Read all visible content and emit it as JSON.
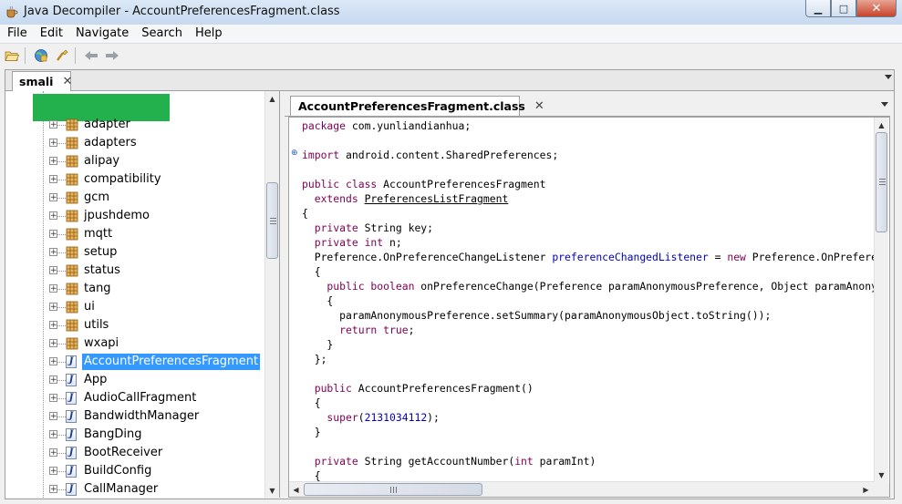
{
  "window": {
    "title": "Java Decompiler - AccountPreferencesFragment.class",
    "controls": {
      "minimize": "▁",
      "maximize": "□",
      "close": "✕"
    }
  },
  "menu": [
    "File",
    "Edit",
    "Navigate",
    "Search",
    "Help"
  ],
  "toolbar": {
    "buttons": [
      "open-file-icon",
      "open-type-icon",
      "search-icon",
      "back-arrow-icon",
      "forward-arrow-icon"
    ]
  },
  "outer_tab": {
    "label": "smali",
    "close": "✕"
  },
  "editor_tab": {
    "label": "AccountPreferencesFragment.class",
    "close": "✕"
  },
  "tree": {
    "packages": [
      "adapter",
      "adapters",
      "alipay",
      "compatibility",
      "gcm",
      "jpushdemo",
      "mqtt",
      "setup",
      "status",
      "tang",
      "ui",
      "utils",
      "wxapi"
    ],
    "classes": [
      "AccountPreferencesFragment",
      "App",
      "AudioCallFragment",
      "BandwidthManager",
      "BangDing",
      "BootReceiver",
      "BuildConfig",
      "CallManager"
    ],
    "selected": "AccountPreferencesFragment",
    "expander_symbol": "+",
    "class_icon_glyph": "J"
  },
  "code": {
    "package_kw": "package",
    "package_name": " com.yunliandianhua;",
    "import_kw": "import",
    "import_name": " android.content.SharedPreferences;",
    "class_decl_kw": "public class",
    "class_name": " AccountPreferencesFragment",
    "extends_kw": "  extends ",
    "extends_name": "PreferencesListFragment",
    "open_brace": "{",
    "field1_kw": "  private",
    "field1_rest": " String key;",
    "field2_kw": "  private int",
    "field2_rest": " n;",
    "listener_type": "  Preference.OnPreferenceChangeListener ",
    "listener_name": "preferenceChangedListener",
    "listener_eq": " = ",
    "listener_new": "new",
    "listener_rest": " Preference.OnPreferenceChangeListener()",
    "brace_l2_open": "  {",
    "method_kw": "    public boolean",
    "method_rest": " onPreferenceChange(Preference paramAnonymousPreference, Object paramAnonymousObject)",
    "brace_l3_open": "    {",
    "call_line": "      paramAnonymousPreference.setSummary(paramAnonymousObject.toString());",
    "return_kw": "      return true",
    "return_end": ";",
    "brace_l3_close": "    }",
    "brace_l2_close": "  };",
    "ctor_kw": "  public",
    "ctor_rest": " AccountPreferencesFragment()",
    "ctor_open": "  {",
    "super_kw": "    super",
    "super_open": "(",
    "super_num": "2131034112",
    "super_close": ");",
    "ctor_close": "  }",
    "getter_kw": "  private",
    "getter_mid": " String getAccountNumber(",
    "getter_int": "int",
    "getter_end": " paramInt)",
    "getter_open": "  {",
    "fold_symbol": "⊕"
  },
  "scroll": {
    "up": "▲",
    "down": "▼",
    "left": "◀",
    "right": "▶"
  }
}
